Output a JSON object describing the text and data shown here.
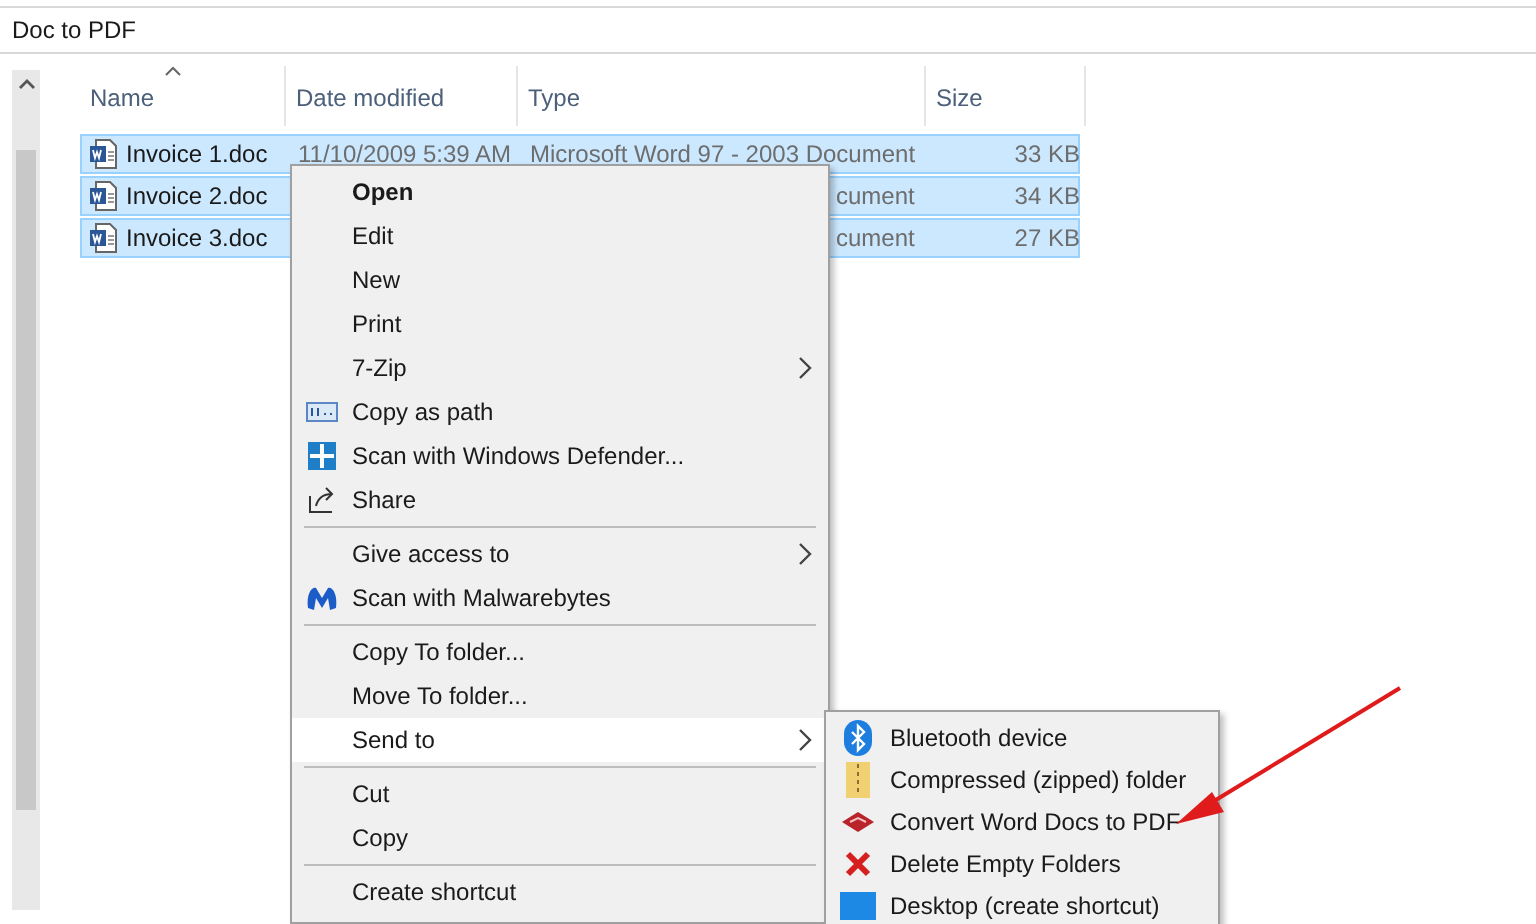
{
  "window": {
    "title": "Doc to PDF"
  },
  "columns": [
    {
      "label": "Name",
      "sorted": true
    },
    {
      "label": "Date modified",
      "sorted": false
    },
    {
      "label": "Type",
      "sorted": false
    },
    {
      "label": "Size",
      "sorted": false
    }
  ],
  "files": [
    {
      "name": "Invoice 1.doc",
      "date": "11/10/2009 5:39 AM",
      "type": "Microsoft Word 97 - 2003 Document",
      "size": "33 KB",
      "selected": true
    },
    {
      "name": "Invoice 2.doc",
      "type": "cument",
      "size": "34 KB",
      "selected": true
    },
    {
      "name": "Invoice 3.doc",
      "type": "cument",
      "size": "27 KB",
      "selected": true
    }
  ],
  "context_menu": [
    {
      "kind": "item",
      "label": "Open",
      "bold": true,
      "submenu": false,
      "selected": false
    },
    {
      "kind": "item",
      "label": "Edit",
      "bold": false,
      "submenu": false,
      "selected": false
    },
    {
      "kind": "item",
      "label": "New",
      "bold": false,
      "submenu": false,
      "selected": false
    },
    {
      "kind": "item",
      "label": "Print",
      "bold": false,
      "submenu": false,
      "selected": false
    },
    {
      "kind": "item",
      "label": "7-Zip",
      "bold": false,
      "submenu": true,
      "selected": false
    },
    {
      "kind": "item",
      "label": "Copy as path",
      "bold": false,
      "submenu": false,
      "selected": false
    },
    {
      "kind": "item",
      "label": "Scan with Windows Defender...",
      "bold": false,
      "submenu": false,
      "selected": false
    },
    {
      "kind": "item",
      "label": "Share",
      "bold": false,
      "submenu": false,
      "selected": false
    },
    {
      "kind": "separator"
    },
    {
      "kind": "item",
      "label": "Give access to",
      "bold": false,
      "submenu": true,
      "selected": false
    },
    {
      "kind": "item",
      "label": "Scan with Malwarebytes",
      "bold": false,
      "submenu": false,
      "selected": false
    },
    {
      "kind": "separator"
    },
    {
      "kind": "item",
      "label": "Copy To folder...",
      "bold": false,
      "submenu": false,
      "selected": false
    },
    {
      "kind": "item",
      "label": "Move To folder...",
      "bold": false,
      "submenu": false,
      "selected": false
    },
    {
      "kind": "item",
      "label": "Send to",
      "bold": false,
      "submenu": true,
      "selected": true
    },
    {
      "kind": "separator"
    },
    {
      "kind": "item",
      "label": "Cut",
      "bold": false,
      "submenu": false,
      "selected": false
    },
    {
      "kind": "item",
      "label": "Copy",
      "bold": false,
      "submenu": false,
      "selected": false
    },
    {
      "kind": "separator"
    },
    {
      "kind": "item",
      "label": "Create shortcut",
      "bold": false,
      "submenu": false,
      "selected": false
    }
  ],
  "send_to_menu": [
    {
      "label": "Bluetooth device"
    },
    {
      "label": "Compressed (zipped) folder"
    },
    {
      "label": "Convert Word Docs to PDF"
    },
    {
      "label": "Delete Empty Folders"
    },
    {
      "label": "Desktop (create shortcut)"
    }
  ]
}
